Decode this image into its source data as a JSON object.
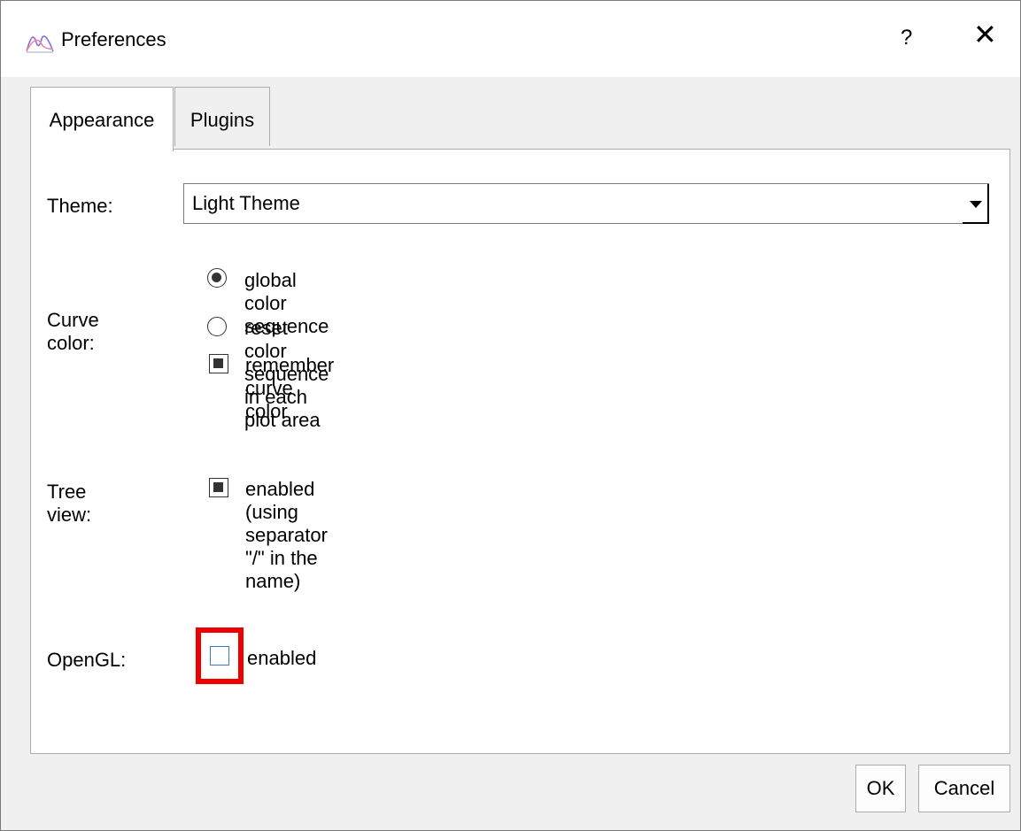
{
  "window": {
    "title": "Preferences",
    "help": "?",
    "close": "✕"
  },
  "tabs": [
    {
      "label": "Appearance",
      "active": true
    },
    {
      "label": "Plugins",
      "active": false
    }
  ],
  "theme": {
    "label": "Theme:",
    "value": "Light Theme"
  },
  "curve_color": {
    "label": "Curve color:",
    "options": [
      {
        "label": "global color sequence",
        "checked": true
      },
      {
        "label": "reset color sequence in each plot area",
        "checked": false
      }
    ],
    "remember": {
      "label": "remember curve color",
      "checked": true
    }
  },
  "tree_view": {
    "label": "Tree view:",
    "option": {
      "label": "enabled (using separator \"/\" in the name)",
      "checked": true
    }
  },
  "opengl": {
    "label": "OpenGL:",
    "option": {
      "label": "enabled",
      "checked": false
    }
  },
  "buttons": {
    "ok": "OK",
    "cancel": "Cancel"
  },
  "colors": {
    "highlight": "#ee0000",
    "focus_border": "#3d7bbf"
  },
  "icons": {
    "app": "plot-curve-icon",
    "close": "close-icon"
  }
}
